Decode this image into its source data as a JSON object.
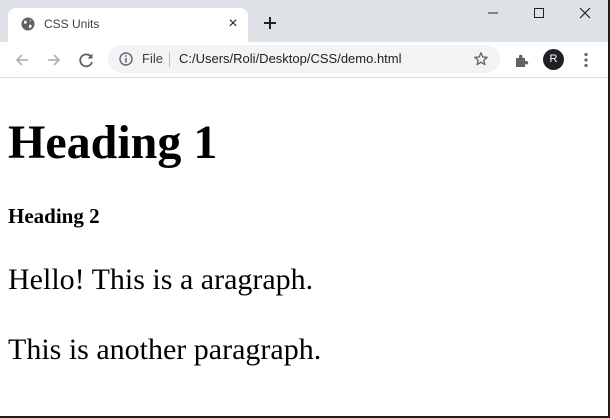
{
  "browser": {
    "tab": {
      "title": "CSS Units",
      "favicon": "globe-icon",
      "close_glyph": "×"
    },
    "new_tab_icon": "plus-icon",
    "window_controls": [
      "minimize-icon",
      "maximize-icon",
      "close-icon"
    ],
    "toolbar": {
      "back_icon": "arrow-left-icon",
      "forward_icon": "arrow-right-icon",
      "reload_icon": "reload-icon",
      "site_info_icon": "info-icon",
      "scheme_label": "File",
      "url": "C:/Users/Roli/Desktop/CSS/demo.html",
      "bookmark_icon": "star-icon",
      "extensions_icon": "puzzle-icon",
      "profile_initial": "R",
      "menu_icon": "kebab-menu-icon"
    },
    "colors": {
      "tabstrip": "#dee1e6",
      "omnibox": "#f1f3f4",
      "avatar": "#202124"
    }
  },
  "page": {
    "heading1": "Heading 1",
    "heading2": "Heading 2",
    "paragraph1": "Hello! This is a aragraph.",
    "paragraph2": "This is another paragraph."
  }
}
